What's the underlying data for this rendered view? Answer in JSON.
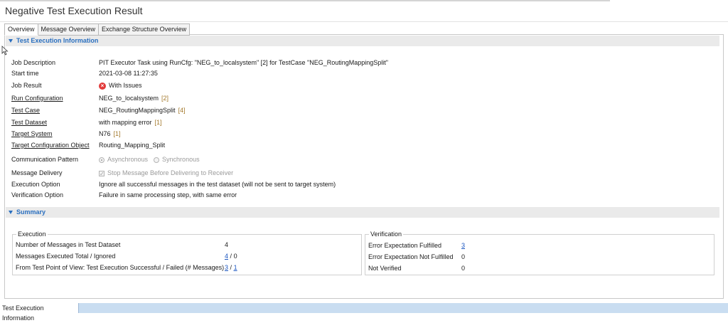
{
  "window": {
    "title": "Negative Test Execution Result"
  },
  "tabs": [
    {
      "label": "Overview",
      "active": true
    },
    {
      "label": "Message Overview",
      "active": false
    },
    {
      "label": "Exchange Structure Overview",
      "active": false
    }
  ],
  "info_section": {
    "header": "Test Execution Information",
    "rows": {
      "job_description": {
        "label": "Job Description",
        "value": "PIT Executor Task using RunCfg: \"NEG_to_localsystem\" [2] for TestCase \"NEG_RoutingMappingSplit\""
      },
      "start_time": {
        "label": "Start time",
        "value": "2021-03-08 11:27:35"
      },
      "job_result": {
        "label": "Job Result",
        "value": "With Issues",
        "icon": "error-icon"
      },
      "run_configuration": {
        "label": "Run Configuration",
        "value": "NEG_to_localsystem",
        "ref": "[2]"
      },
      "test_case": {
        "label": "Test Case",
        "value": "NEG_RoutingMappingSplit",
        "ref": "[4]"
      },
      "test_dataset": {
        "label": "Test Dataset",
        "value": "with mapping error",
        "ref": "[1]"
      },
      "target_system": {
        "label": "Target System",
        "value": "N76",
        "ref": "[1]"
      },
      "target_configuration_object": {
        "label": "Target Configuration Object",
        "value": "Routing_Mapping_Split"
      },
      "communication_pattern": {
        "label": "Communication Pattern",
        "option_async": "Asynchronous",
        "option_sync": "Synchronous",
        "selected": "Asynchronous"
      },
      "message_delivery": {
        "label": "Message Delivery",
        "checkbox_label": "Stop Message Before Delivering to Receiver",
        "checked": true
      },
      "execution_option": {
        "label": "Execution Option",
        "value": "Ignore all successful messages in the test dataset (will not be sent to target system)"
      },
      "verification_option": {
        "label": "Verification Option",
        "value": "Failure in same processing step, with same error"
      }
    }
  },
  "summary_section": {
    "header": "Summary",
    "execution": {
      "title": "Execution",
      "number_label": "Number of Messages in Test Dataset",
      "number_value": "4",
      "executed_label": "Messages Executed Total / Ignored",
      "executed_total": "4",
      "separator": "/",
      "ignored": "0",
      "result_label": "From Test Point of View: Test Execution Successful / Failed (# Messages)",
      "successful": "3",
      "failed": "1"
    },
    "verification": {
      "title": "Verification",
      "fulfilled_label": "Error Expectation Fulfilled",
      "fulfilled_value": "3",
      "not_fulfilled_label": "Error Expectation Not Fulfilled",
      "not_fulfilled_value": "0",
      "not_verified_label": "Not Verified",
      "not_verified_value": "0"
    }
  },
  "status_bar": {
    "label": "Test Execution Information"
  },
  "colors": {
    "accent": "#2a6fbf",
    "link": "#1a55c0",
    "error": "#e23a3a",
    "ref": "#a47a2e",
    "status_bar": "#c9ddf1"
  }
}
